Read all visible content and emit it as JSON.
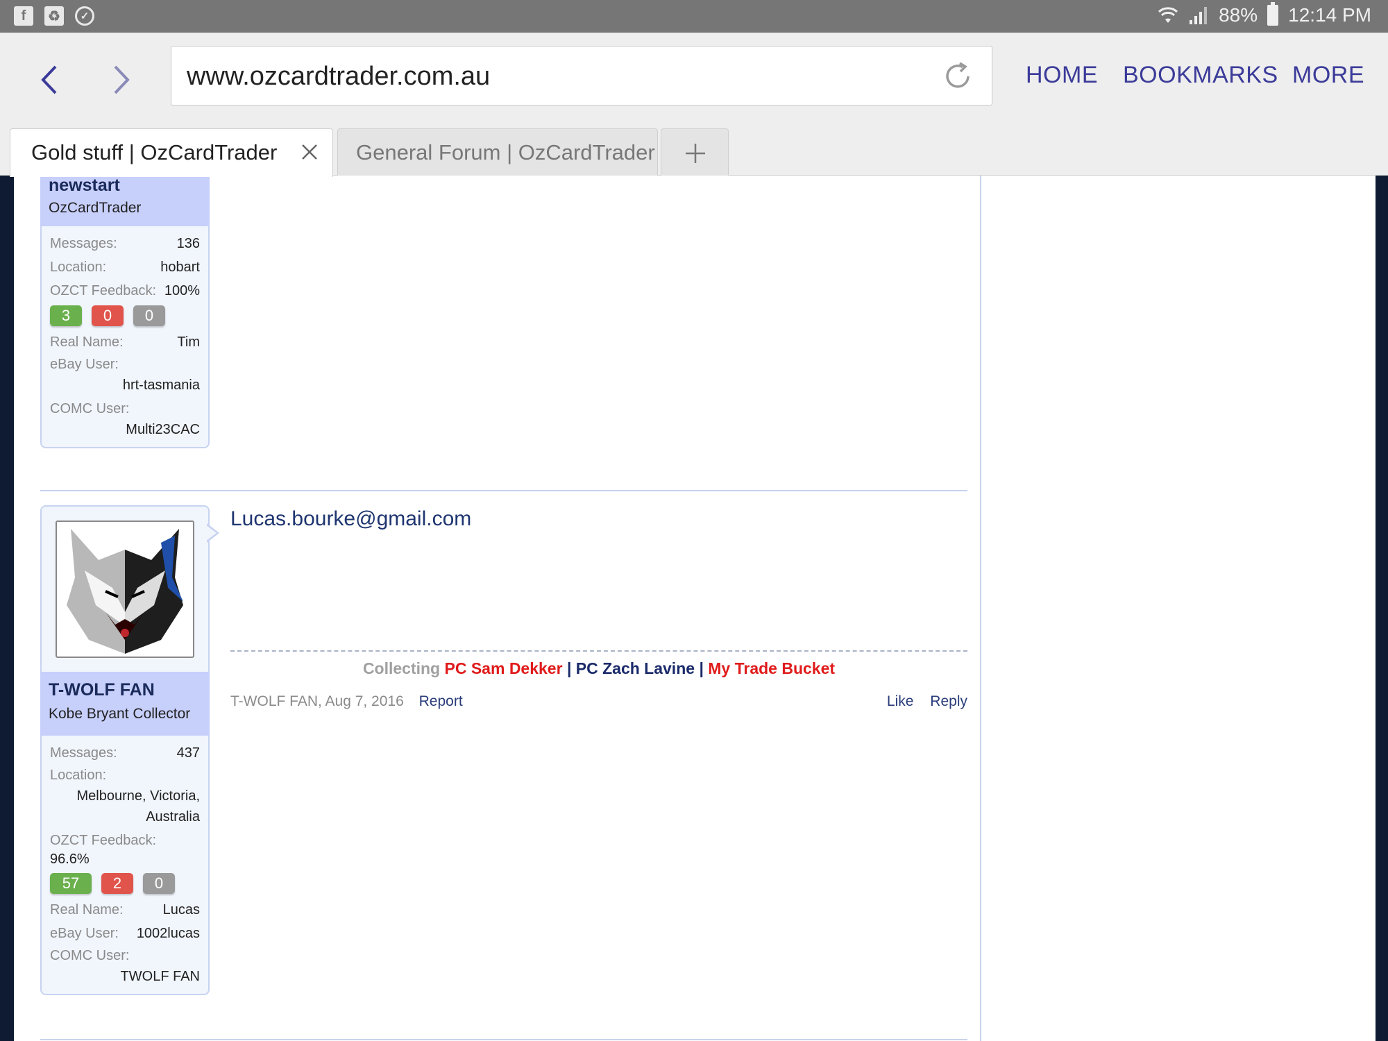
{
  "status_bar": {
    "battery": "88%",
    "time": "12:14 PM",
    "left_icons": [
      "facebook-icon",
      "recycle-icon",
      "shield-check-icon"
    ]
  },
  "browser": {
    "url": "www.ozcardtrader.com.au",
    "home_label": "HOME",
    "bookmarks_label": "BOOKMARKS",
    "more_label": "MORE",
    "tabs": [
      {
        "label": "Gold stuff | OzCardTrader",
        "active": true
      },
      {
        "label": "General Forum | OzCardTrader",
        "active": false
      }
    ]
  },
  "posts": [
    {
      "user": {
        "name": "newstart",
        "title": "OzCardTrader",
        "messages_label": "Messages:",
        "messages": "136",
        "location_label": "Location:",
        "location": "hobart",
        "feedback_label": "OZCT Feedback:",
        "feedback": "100%",
        "feedback_counts": {
          "positive": "3",
          "negative": "0",
          "neutral": "0"
        },
        "real_name_label": "Real Name:",
        "real_name": "Tim",
        "ebay_label": "eBay User:",
        "ebay": "hrt-tasmania",
        "comc_label": "COMC User:",
        "comc": "Multi23CAC"
      }
    },
    {
      "user": {
        "name": "T-WOLF FAN",
        "title": "Kobe Bryant Collector",
        "messages_label": "Messages:",
        "messages": "437",
        "location_label": "Location:",
        "location_line1": "Melbourne, Victoria,",
        "location_line2": "Australia",
        "feedback_label": "OZCT Feedback:",
        "feedback": "96.6%",
        "feedback_counts": {
          "positive": "57",
          "negative": "2",
          "neutral": "0"
        },
        "real_name_label": "Real Name:",
        "real_name": "Lucas",
        "ebay_label": "eBay User:",
        "ebay": "1002lucas",
        "comc_label": "COMC User:",
        "comc": "TWOLF FAN"
      },
      "message": "Lucas.bourke@gmail.com",
      "signature": {
        "label": "Collecting",
        "link1": "PC Sam Dekker",
        "sep1": "|",
        "link2": "PC Zach Lavine",
        "sep2": "|",
        "link3": "My Trade Bucket"
      },
      "meta": {
        "author_date": "T-WOLF FAN, Aug 7, 2016",
        "report": "Report",
        "like": "Like",
        "reply": "Reply"
      }
    }
  ]
}
